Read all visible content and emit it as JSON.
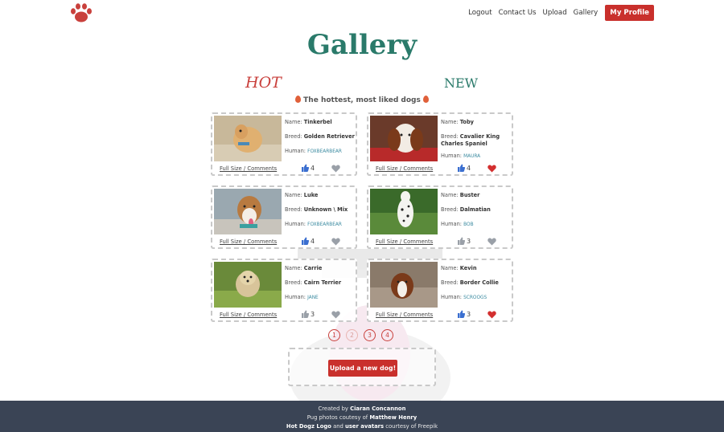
{
  "nav": {
    "links": [
      "Logout",
      "Contact Us",
      "Upload",
      "Gallery"
    ],
    "profile": "My Profile"
  },
  "title": "Gallery",
  "tabs": {
    "hot": "HOT",
    "new": "NEW"
  },
  "subtitle": "The hottest, most liked dogs",
  "labels": {
    "name": "Name:",
    "breed": "Breed:",
    "human": "Human:",
    "fullsize": "Full Size / Comments"
  },
  "dogs": [
    {
      "name": "Tinkerbel",
      "breed": "Golden Retriever",
      "human": "FOXBEARBEAR",
      "likes": "4",
      "liked": false
    },
    {
      "name": "Toby",
      "breed": "Cavalier King Charles Spaniel",
      "human": "MAURA",
      "likes": "4",
      "liked": true
    },
    {
      "name": "Luke",
      "breed": "Unknown \\ Mix",
      "human": "FOXBEARBEAR",
      "likes": "4",
      "liked": false
    },
    {
      "name": "Buster",
      "breed": "Dalmatian",
      "human": "BOB",
      "likes": "3",
      "liked": false
    },
    {
      "name": "Carrie",
      "breed": "Cairn Terrier",
      "human": "JANE",
      "likes": "3",
      "liked": false
    },
    {
      "name": "Kevin",
      "breed": "Border Collie",
      "human": "SCROOGS",
      "likes": "3",
      "liked": true
    }
  ],
  "pages": [
    "1",
    "2",
    "3",
    "4"
  ],
  "upload_label": "Upload a new dog!",
  "footer": {
    "created_prefix": "Created by ",
    "created_name": "Ciaran Concannon",
    "photos_prefix": "Pug photos coutesy of ",
    "photos_name": "Matthew Henry",
    "logo_label": "Hot Dogz Logo",
    "and": " and ",
    "avatars_label": "user avatars",
    "freepik_suffix": " courtesy of Freepik"
  },
  "colors": {
    "accent_red": "#c9302c",
    "accent_teal": "#2a7a6a",
    "footer_bg": "#3a4455",
    "heart_red": "#d32f2f",
    "heart_grey": "#9aa0a8",
    "thumb_blue": "#3b6fd0"
  }
}
